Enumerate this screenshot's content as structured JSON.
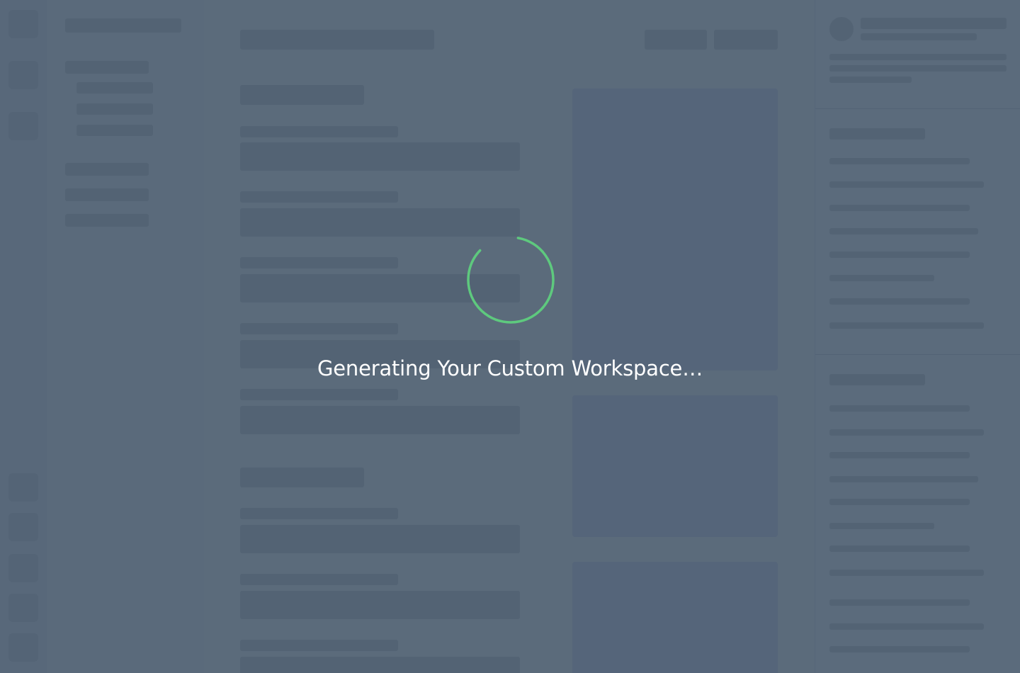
{
  "loading": {
    "message": "Generating Your Custom Workspace…",
    "spinner_icon": "loading-spinner-icon",
    "spinner_color": "#5ec97e"
  },
  "colors": {
    "background": "#5b6b7b",
    "placeholder": "#536374",
    "text": "#ffffff"
  }
}
